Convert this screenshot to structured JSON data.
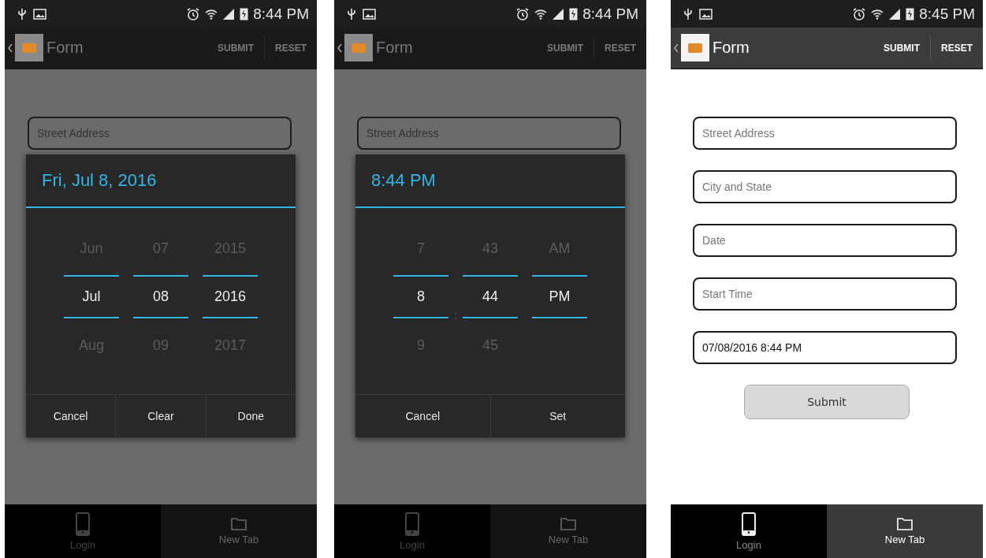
{
  "phones": [
    {
      "status_bar": {
        "time": "8:44 PM"
      },
      "action_bar": {
        "title": "Form",
        "actions": [
          "SUBMIT",
          "RESET"
        ]
      },
      "dimmed": true,
      "fields": [
        {
          "placeholder": "Street Address"
        }
      ],
      "dialog": {
        "header": "Fri, Jul 8, 2016",
        "columns": [
          {
            "above": "Jun",
            "current": "Jul",
            "below": "Aug"
          },
          {
            "above": "07",
            "current": "08",
            "below": "09"
          },
          {
            "above": "2015",
            "current": "2016",
            "below": "2017"
          }
        ],
        "buttons": [
          "Cancel",
          "Clear",
          "Done"
        ]
      },
      "tabs": [
        {
          "label": "Login",
          "selected": false
        },
        {
          "label": "New Tab",
          "selected": true
        }
      ]
    },
    {
      "status_bar": {
        "time": "8:44 PM"
      },
      "action_bar": {
        "title": "Form",
        "actions": [
          "SUBMIT",
          "RESET"
        ]
      },
      "dimmed": true,
      "fields": [
        {
          "placeholder": "Street Address"
        }
      ],
      "dialog": {
        "header": "8:44 PM",
        "separator": ":",
        "columns": [
          {
            "above": "7",
            "current": "8",
            "below": "9"
          },
          {
            "above": "43",
            "current": "44",
            "below": "45"
          },
          {
            "above": "AM",
            "current": "PM"
          }
        ],
        "buttons": [
          "Cancel",
          "Set"
        ]
      },
      "tabs": [
        {
          "label": "Login",
          "selected": false
        },
        {
          "label": "New Tab",
          "selected": true
        }
      ]
    },
    {
      "status_bar": {
        "time": "8:45 PM"
      },
      "action_bar": {
        "title": "Form",
        "actions": [
          "SUBMIT",
          "RESET"
        ]
      },
      "dimmed": false,
      "fields": [
        {
          "placeholder": "Street Address"
        },
        {
          "placeholder": "City and State"
        },
        {
          "placeholder": "Date"
        },
        {
          "placeholder": "Start Time"
        },
        {
          "value": "07/08/2016 8:44 PM"
        }
      ],
      "submit_button": "Submit",
      "tabs": [
        {
          "label": "Login",
          "selected": false
        },
        {
          "label": "New Tab",
          "selected": true
        }
      ]
    }
  ]
}
